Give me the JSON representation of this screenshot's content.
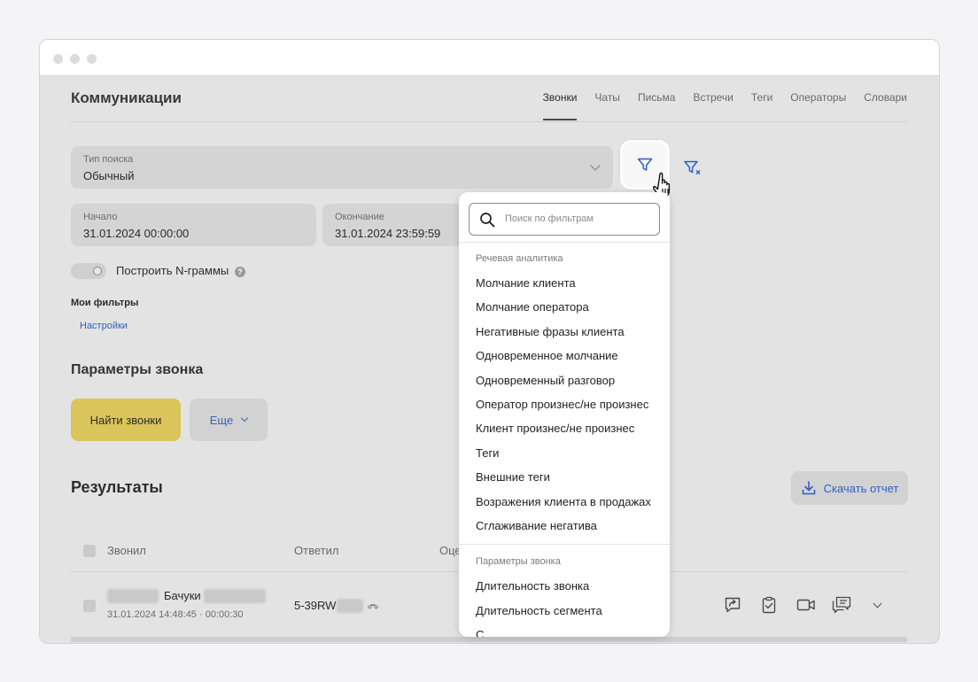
{
  "header": {
    "title": "Коммуникации",
    "tabs": [
      {
        "label": "Звонки",
        "active": true
      },
      {
        "label": "Чаты"
      },
      {
        "label": "Письма"
      },
      {
        "label": "Встречи"
      },
      {
        "label": "Теги"
      },
      {
        "label": "Операторы"
      },
      {
        "label": "Словари"
      }
    ]
  },
  "search_type": {
    "label": "Тип поиска",
    "value": "Обычный"
  },
  "date_range": {
    "start": {
      "label": "Начало",
      "value": "31.01.2024 00:00:00"
    },
    "end": {
      "label": "Окончание",
      "value": "31.01.2024 23:59:59"
    }
  },
  "ngram": {
    "label": "Построить N-граммы",
    "help": "?",
    "enabled": false
  },
  "my_filters": {
    "title": "Мои фильтры",
    "settings_link": "Настройки"
  },
  "call_params": {
    "title": "Параметры звонка",
    "find_button": "Найти звонки",
    "more_button": "Еще"
  },
  "results": {
    "title": "Результаты",
    "download_button": "Скачать отчет",
    "columns": [
      "Звонил",
      "Ответил",
      "Оце"
    ],
    "rows": [
      {
        "caller_name": "Бачуки",
        "meta": "31.01.2024 14:48:45 · 00:00:30",
        "answered": "5-39RW"
      }
    ]
  },
  "filter_dropdown": {
    "search_placeholder": "Поиск по фильтрам",
    "groups": [
      {
        "label": "Речевая аналитика",
        "items": [
          "Молчание клиента",
          "Молчание оператора",
          "Негативные фразы клиента",
          "Одновременное молчание",
          "Одновременный разговор",
          "Оператор произнес/не произнес",
          "Клиент произнес/не произнес",
          "Теги",
          "Внешние теги",
          "Возражения клиента в продажах",
          "Сглаживание негатива"
        ]
      },
      {
        "label": "Параметры звонка",
        "items": [
          "Длительность звонка",
          "Длительность сегмента",
          "С"
        ]
      }
    ]
  },
  "icons": {
    "filter": "filter-icon",
    "clear_filter": "filter-clear-icon",
    "cursor": "hand-pointer-icon",
    "search": "search-icon",
    "download": "download-icon",
    "row_actions": [
      "share-comment-icon",
      "clipboard-check-icon",
      "video-icon",
      "chat-icon",
      "chevron-down-icon"
    ]
  },
  "colors": {
    "accent_blue": "#2f5fc4",
    "primary_yellow": "#dac55b"
  }
}
